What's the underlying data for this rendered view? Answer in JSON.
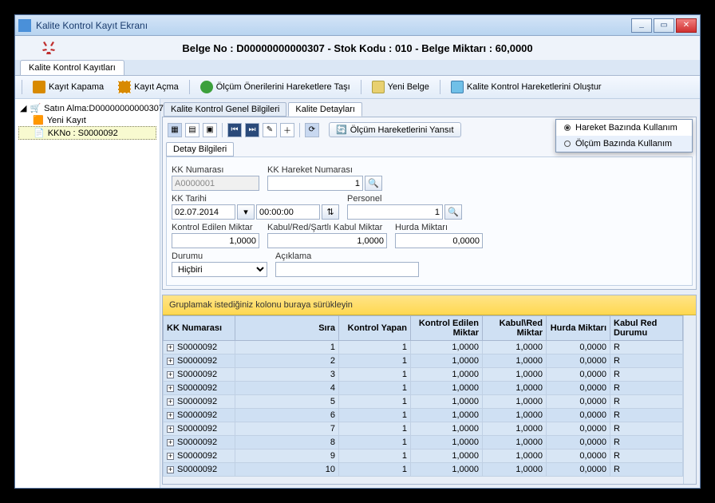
{
  "window": {
    "title": "Kalite Kontrol Kayıt Ekranı"
  },
  "header": {
    "line": "Belge No : D00000000000307 - Stok Kodu : 010 - Belge Miktarı : 60,0000"
  },
  "main_tabs": {
    "tab1": "Kalite Kontrol Kayıtları"
  },
  "toolbar": {
    "kayit_kapama": "Kayıt Kapama",
    "kayit_acma": "Kayıt Açma",
    "olcum_oneri": "Ölçüm Önerilerini Hareketlere Taşı",
    "yeni_belge": "Yeni Belge",
    "hareket_olustur": "Kalite Kontrol Hareketlerini Oluştur"
  },
  "tree": {
    "root": "Satın Alma:D00000000000307",
    "child1": "Yeni Kayıt",
    "child2": "KKNo : S0000092"
  },
  "subtabs": {
    "genel": "Kalite Kontrol Genel Bilgileri",
    "detay": "Kalite Detayları"
  },
  "icon_toolbar": {
    "reflect": "Ölçüm Hareketlerini Yansıt"
  },
  "floatmenu": {
    "opt1": "Hareket Bazında Kullanım",
    "opt2": "Ölçüm Bazında Kullanım"
  },
  "detailtab": "Detay Bilgileri",
  "fields": {
    "kk_num_label": "KK Numarası",
    "kk_num_value": "A0000001",
    "kk_hareket_label": "KK Hareket Numarası",
    "kk_hareket_value": "1",
    "kk_tarihi_label": "KK Tarihi",
    "kk_tarihi_date": "02.07.2014",
    "kk_tarihi_time": "00:00:00",
    "personel_label": "Personel",
    "personel_value": "1",
    "kontrol_miktar_label": "Kontrol Edilen Miktar",
    "kontrol_miktar_value": "1,0000",
    "kabul_red_label": "Kabul/Red/Şartlı Kabul Miktar",
    "kabul_red_value": "1,0000",
    "hurda_label": "Hurda Miktarı",
    "hurda_value": "0,0000",
    "durumu_label": "Durumu",
    "durumu_value": "Hiçbiri",
    "aciklama_label": "Açıklama",
    "aciklama_value": ""
  },
  "grid": {
    "group_hint": "Gruplamak istediğiniz kolonu buraya sürükleyin",
    "cols": {
      "kk": "KK Numarası",
      "sira": "Sıra",
      "ky": "Kontrol Yapan",
      "kem": "Kontrol Edilen Miktar",
      "krm": "Kabul\\Red Miktar",
      "hm": "Hurda Miktarı",
      "krd": "Kabul Red Durumu"
    },
    "rows": [
      {
        "kk": "S0000092",
        "sira": "1",
        "ky": "1",
        "kem": "1,0000",
        "krm": "1,0000",
        "hm": "0,0000",
        "krd": "R"
      },
      {
        "kk": "S0000092",
        "sira": "2",
        "ky": "1",
        "kem": "1,0000",
        "krm": "1,0000",
        "hm": "0,0000",
        "krd": "R"
      },
      {
        "kk": "S0000092",
        "sira": "3",
        "ky": "1",
        "kem": "1,0000",
        "krm": "1,0000",
        "hm": "0,0000",
        "krd": "R"
      },
      {
        "kk": "S0000092",
        "sira": "4",
        "ky": "1",
        "kem": "1,0000",
        "krm": "1,0000",
        "hm": "0,0000",
        "krd": "R"
      },
      {
        "kk": "S0000092",
        "sira": "5",
        "ky": "1",
        "kem": "1,0000",
        "krm": "1,0000",
        "hm": "0,0000",
        "krd": "R"
      },
      {
        "kk": "S0000092",
        "sira": "6",
        "ky": "1",
        "kem": "1,0000",
        "krm": "1,0000",
        "hm": "0,0000",
        "krd": "R"
      },
      {
        "kk": "S0000092",
        "sira": "7",
        "ky": "1",
        "kem": "1,0000",
        "krm": "1,0000",
        "hm": "0,0000",
        "krd": "R"
      },
      {
        "kk": "S0000092",
        "sira": "8",
        "ky": "1",
        "kem": "1,0000",
        "krm": "1,0000",
        "hm": "0,0000",
        "krd": "R"
      },
      {
        "kk": "S0000092",
        "sira": "9",
        "ky": "1",
        "kem": "1,0000",
        "krm": "1,0000",
        "hm": "0,0000",
        "krd": "R"
      },
      {
        "kk": "S0000092",
        "sira": "10",
        "ky": "1",
        "kem": "1,0000",
        "krm": "1,0000",
        "hm": "0,0000",
        "krd": "R"
      }
    ]
  }
}
